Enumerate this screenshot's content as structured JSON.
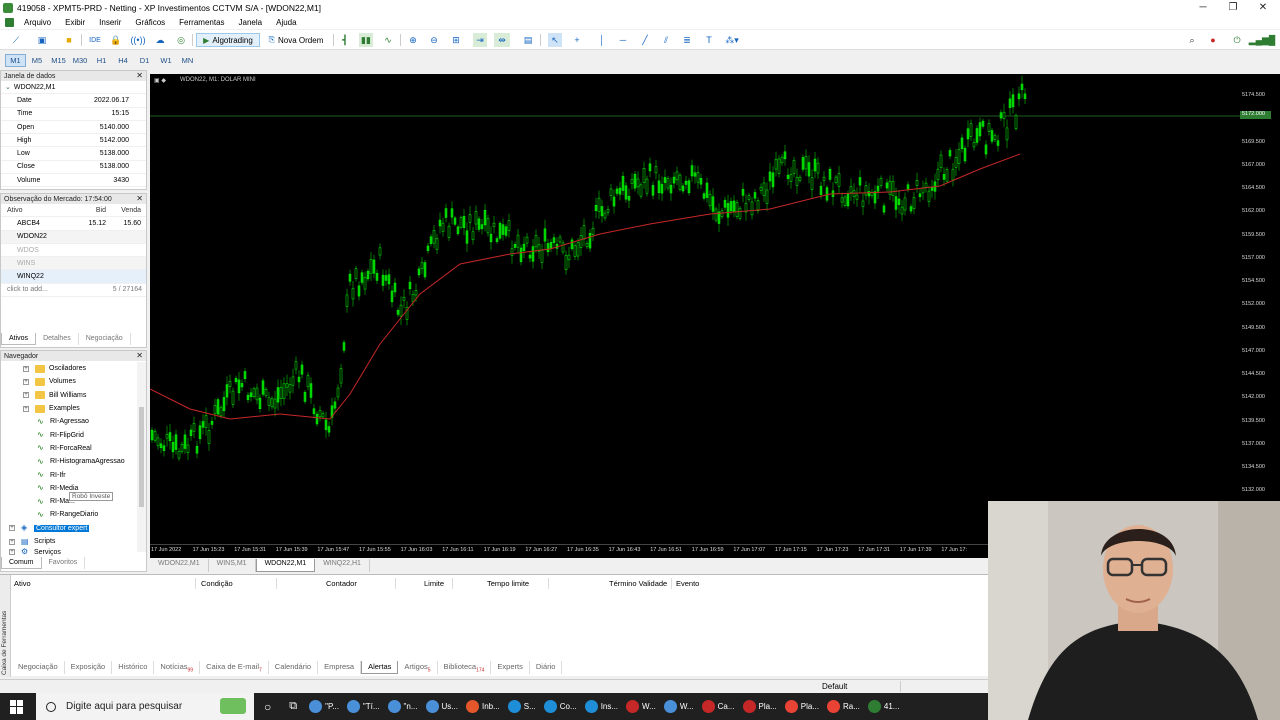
{
  "window": {
    "title": "419058 - XPMT5-PRD - Netting - XP Investimentos CCTVM S/A - [WDON22,M1]",
    "minimize": "─",
    "maximize": "❐",
    "close": "✕"
  },
  "menu": [
    "Arquivo",
    "Exibir",
    "Inserir",
    "Gráficos",
    "Ferramentas",
    "Janela",
    "Ajuda"
  ],
  "toolbar": {
    "ide_label": "IDE",
    "algotrading_label": "Algotrading",
    "nova_ordem_label": "Nova Ordem"
  },
  "timeframes": [
    "M1",
    "M5",
    "M15",
    "M30",
    "H1",
    "H4",
    "D1",
    "W1",
    "MN"
  ],
  "data_window": {
    "title": "Janela de dados",
    "symbol": "WDON22,M1",
    "rows": [
      {
        "k": "Date",
        "v": "2022.06.17"
      },
      {
        "k": "Time",
        "v": "15:15"
      },
      {
        "k": "Open",
        "v": "5140.000"
      },
      {
        "k": "High",
        "v": "5142.000"
      },
      {
        "k": "Low",
        "v": "5138.000"
      },
      {
        "k": "Close",
        "v": "5138.000"
      },
      {
        "k": "Volume",
        "v": "3430"
      }
    ]
  },
  "market_watch": {
    "title": "Observação do Mercado: 17:54:00",
    "col_ativo": "Ativo",
    "col_bid": "Bid",
    "col_venda": "Venda",
    "rows": [
      {
        "s": "ABCB4",
        "bid": "15.12",
        "ask": "15.60"
      },
      {
        "s": "WDON22",
        "bid": "",
        "ask": ""
      },
      {
        "s": "WDOS",
        "bid": "",
        "ask": ""
      },
      {
        "s": "WINS",
        "bid": "",
        "ask": ""
      },
      {
        "s": "WINQ22",
        "bid": "",
        "ask": ""
      }
    ],
    "add": "click to add...",
    "count": "5 / 27164",
    "tabs": [
      "Ativos",
      "Detalhes",
      "Negociação"
    ]
  },
  "navigator": {
    "title": "Navegador",
    "folders": [
      "Osciladores",
      "Volumes",
      "Bill Williams",
      "Examples"
    ],
    "indicators": [
      "RI-Agressao",
      "RI-FlipGrid",
      "RI-ForcaReal",
      "RI-HistogramaAgressao",
      "RI-Ifr",
      "RI-Media",
      "RI-Ma...",
      "RI-RangeDiario"
    ],
    "tooltip": "Robô Investe",
    "expert": "Consultor expert",
    "scripts": "Scripts",
    "services": "Serviços",
    "tabs": [
      "Comum",
      "Favoritos"
    ]
  },
  "chart": {
    "label": "WDON22, M1: DOLAR MINI",
    "price_ticks": [
      "5174.500",
      "5172.000",
      "5169.500",
      "5167.000",
      "5164.500",
      "5162.000",
      "5159.500",
      "5157.000",
      "5154.500",
      "5152.000",
      "5149.500",
      "5147.000",
      "5144.500",
      "5142.000",
      "5139.500",
      "5137.000",
      "5134.500",
      "5132.000"
    ],
    "current_price": "5172.000",
    "time_ticks": [
      "17 Jun 2022",
      "17 Jun 15:23",
      "17 Jun 15:31",
      "17 Jun 15:39",
      "17 Jun 15:47",
      "17 Jun 15:55",
      "17 Jun 16:03",
      "17 Jun 16:11",
      "17 Jun 16:19",
      "17 Jun 16:27",
      "17 Jun 16:35",
      "17 Jun 16:43",
      "17 Jun 16:51",
      "17 Jun 16:59",
      "17 Jun 17:07",
      "17 Jun 17:15",
      "17 Jun 17:23",
      "17 Jun 17:31",
      "17 Jun 17:39",
      "17 Jun 17:"
    ],
    "tabs": [
      "WDON22,M1",
      "WINS,M1",
      "WDON22,M1",
      "WINQ22,H1"
    ]
  },
  "toolbox": {
    "side_label": "Caixa de Ferramentas",
    "columns": [
      "Ativo",
      "Condição",
      "Contador",
      "Limite",
      "Tempo limite",
      "Término Validade",
      "Evento"
    ],
    "tabs": [
      {
        "label": "Negociação",
        "badge": ""
      },
      {
        "label": "Exposição",
        "badge": ""
      },
      {
        "label": "Histórico",
        "badge": ""
      },
      {
        "label": "Notícias",
        "badge": "99"
      },
      {
        "label": "Caixa de E-mail",
        "badge": "7"
      },
      {
        "label": "Calendário",
        "badge": ""
      },
      {
        "label": "Empresa",
        "badge": ""
      },
      {
        "label": "Alertas",
        "badge": ""
      },
      {
        "label": "Artigos",
        "badge": "5"
      },
      {
        "label": "Biblioteca",
        "badge": "174"
      },
      {
        "label": "Experts",
        "badge": ""
      },
      {
        "label": "Diário",
        "badge": ""
      }
    ]
  },
  "status": {
    "profile": "Default"
  },
  "taskbar": {
    "search_placeholder": "Digite aqui para pesquisar",
    "apps": [
      "\"P...",
      "\"Tí...",
      "\"n...",
      "Us...",
      "Inb...",
      "S...",
      "Co...",
      "Ins...",
      "W...",
      "W...",
      "Ca...",
      "Pla...",
      "Pla...",
      "Ra...",
      "41..."
    ]
  },
  "colors": {
    "chart_bg": "#000000",
    "bull": "#00ff00",
    "ma": "#c62828",
    "selection": "#0078d7"
  }
}
